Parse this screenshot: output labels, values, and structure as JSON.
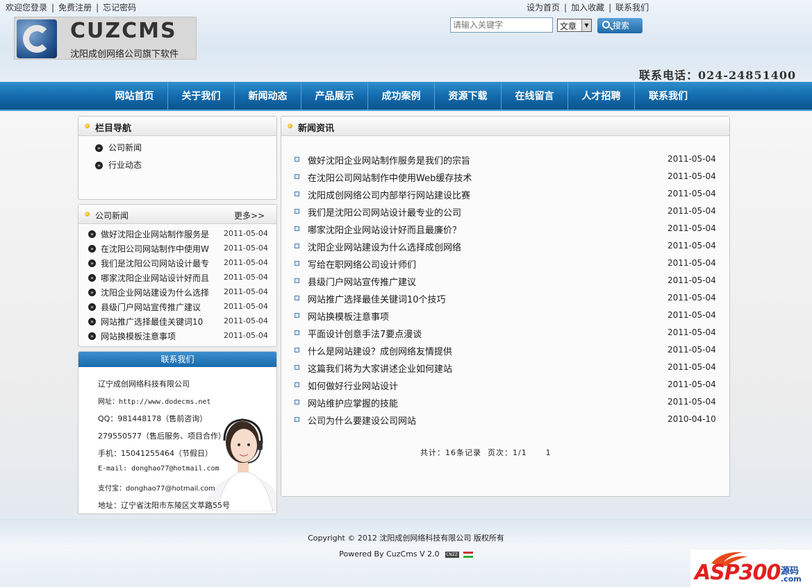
{
  "top_bar": {
    "left_links": [
      "欢迎您登录",
      "免费注册",
      "忘记密码"
    ],
    "right_links": [
      "设为首页",
      "加入收藏",
      "联系我们"
    ]
  },
  "logo": {
    "name": "CUZCMS",
    "subtitle": "沈阳成创网络公司旗下软件"
  },
  "search": {
    "placeholder": "请输入关键字",
    "category": "文章",
    "button_label": "搜索"
  },
  "phone": "联系电话：024-24851400",
  "nav": {
    "items": [
      "网站首页",
      "关于我们",
      "新闻动态",
      "产品展示",
      "成功案例",
      "资源下载",
      "在线留言",
      "人才招聘",
      "联系我们"
    ]
  },
  "sidebar_nav": {
    "title": "栏目导航",
    "items": [
      "公司新闻",
      "行业动态"
    ]
  },
  "company_news": {
    "title": "公司新闻",
    "more": "更多>>",
    "items": [
      {
        "title": "做好沈阳企业网站制作服务是",
        "date": "2011-05-04"
      },
      {
        "title": "在沈阳公司网站制作中使用W",
        "date": "2011-05-04"
      },
      {
        "title": "我们是沈阳公司网站设计最专",
        "date": "2011-05-04"
      },
      {
        "title": "哪家沈阳企业网站设计好而且",
        "date": "2011-05-04"
      },
      {
        "title": "沈阳企业网站建设为什么选择",
        "date": "2011-05-04"
      },
      {
        "title": "县级门户网站宣传推广建议",
        "date": "2011-05-04"
      },
      {
        "title": "网站推广选择最佳关键词10",
        "date": "2011-05-04"
      },
      {
        "title": "网站换模板注意事项",
        "date": "2011-05-04"
      }
    ]
  },
  "contact": {
    "title": "联系我们",
    "lines": [
      "辽宁成创网络科技有限公司",
      "网址：http://www.dodecms.net",
      "QQ：981448178（售前咨询）",
      "279550577（售后服务、项目合作）",
      "手机：15041255464（节假日）",
      "E-mail: donghao77@hotmail.com",
      "支付宝：donghao77@hotmail.com",
      "地址：辽宁省沈阳市东陵区文萃路55号"
    ]
  },
  "main_news": {
    "title": "新闻资讯",
    "items": [
      {
        "title": "做好沈阳企业网站制作服务是我们的宗旨",
        "date": "2011-05-04"
      },
      {
        "title": "在沈阳公司网站制作中使用Web缓存技术",
        "date": "2011-05-04"
      },
      {
        "title": "沈阳成创网络公司内部举行网站建设比赛",
        "date": "2011-05-04"
      },
      {
        "title": "我们是沈阳公司网站设计最专业的公司",
        "date": "2011-05-04"
      },
      {
        "title": "哪家沈阳企业网站设计好而且最廉价？",
        "date": "2011-05-04"
      },
      {
        "title": "沈阳企业网站建设为什么选择成创网络",
        "date": "2011-05-04"
      },
      {
        "title": "写给在职网络公司设计师们",
        "date": "2011-05-04"
      },
      {
        "title": "县级门户网站宣传推广建议",
        "date": "2011-05-04"
      },
      {
        "title": "网站推广选择最佳关键词10个技巧",
        "date": "2011-05-04"
      },
      {
        "title": "网站换模板注意事项",
        "date": "2011-05-04"
      },
      {
        "title": "平面设计创意手法7要点漫谈",
        "date": "2011-05-04"
      },
      {
        "title": "什么是网站建设？成创网络友情提供",
        "date": "2011-05-04"
      },
      {
        "title": "这篇我们将为大家讲述企业如何建站",
        "date": "2011-05-04"
      },
      {
        "title": "如何做好行业网站设计",
        "date": "2011-05-04"
      },
      {
        "title": "网站维护应掌握的技能",
        "date": "2011-05-04"
      },
      {
        "title": "公司为什么要建设公司网站",
        "date": "2010-04-10"
      }
    ],
    "pager": "共计：16条记录  页次：1/1      1"
  },
  "footer": {
    "copyright": "Copyright © 2012 沈阳成创网络科技有限公司 版权所有",
    "powered": "Powered By CuzCms V 2.0",
    "badge": "CNZZ"
  },
  "watermark": {
    "text": "ASP300",
    "sub": "源码",
    "domain": ".com"
  }
}
